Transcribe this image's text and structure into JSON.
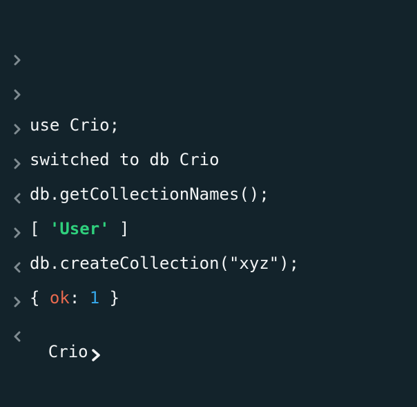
{
  "terminal": {
    "entries": [
      {
        "type": "input",
        "text": ""
      },
      {
        "type": "input",
        "text": ""
      },
      {
        "type": "input",
        "text": ""
      },
      {
        "type": "input",
        "text": "use Crio;"
      },
      {
        "type": "output",
        "text": "switched to db Crio"
      },
      {
        "type": "input",
        "text": "db.getCollectionNames();"
      },
      {
        "type": "output",
        "open": "[ ",
        "string": "'User'",
        "close": " ]"
      },
      {
        "type": "input",
        "text": "db.createCollection(\"xyz\");"
      },
      {
        "type": "output",
        "open": "{ ",
        "key": "ok",
        "colon": ": ",
        "number": "1",
        "close": " }"
      }
    ],
    "prompt": "Crio"
  },
  "icons": {
    "input_marker": "chevron-right-icon",
    "output_marker": "chevron-left-icon",
    "prompt_marker": "chevron-right-icon"
  },
  "colors": {
    "background": "#13232b",
    "text": "#f2f4f5",
    "marker": "#7f8b91",
    "string": "#2fd07d",
    "key": "#e96a4f",
    "number": "#35a6e8"
  }
}
